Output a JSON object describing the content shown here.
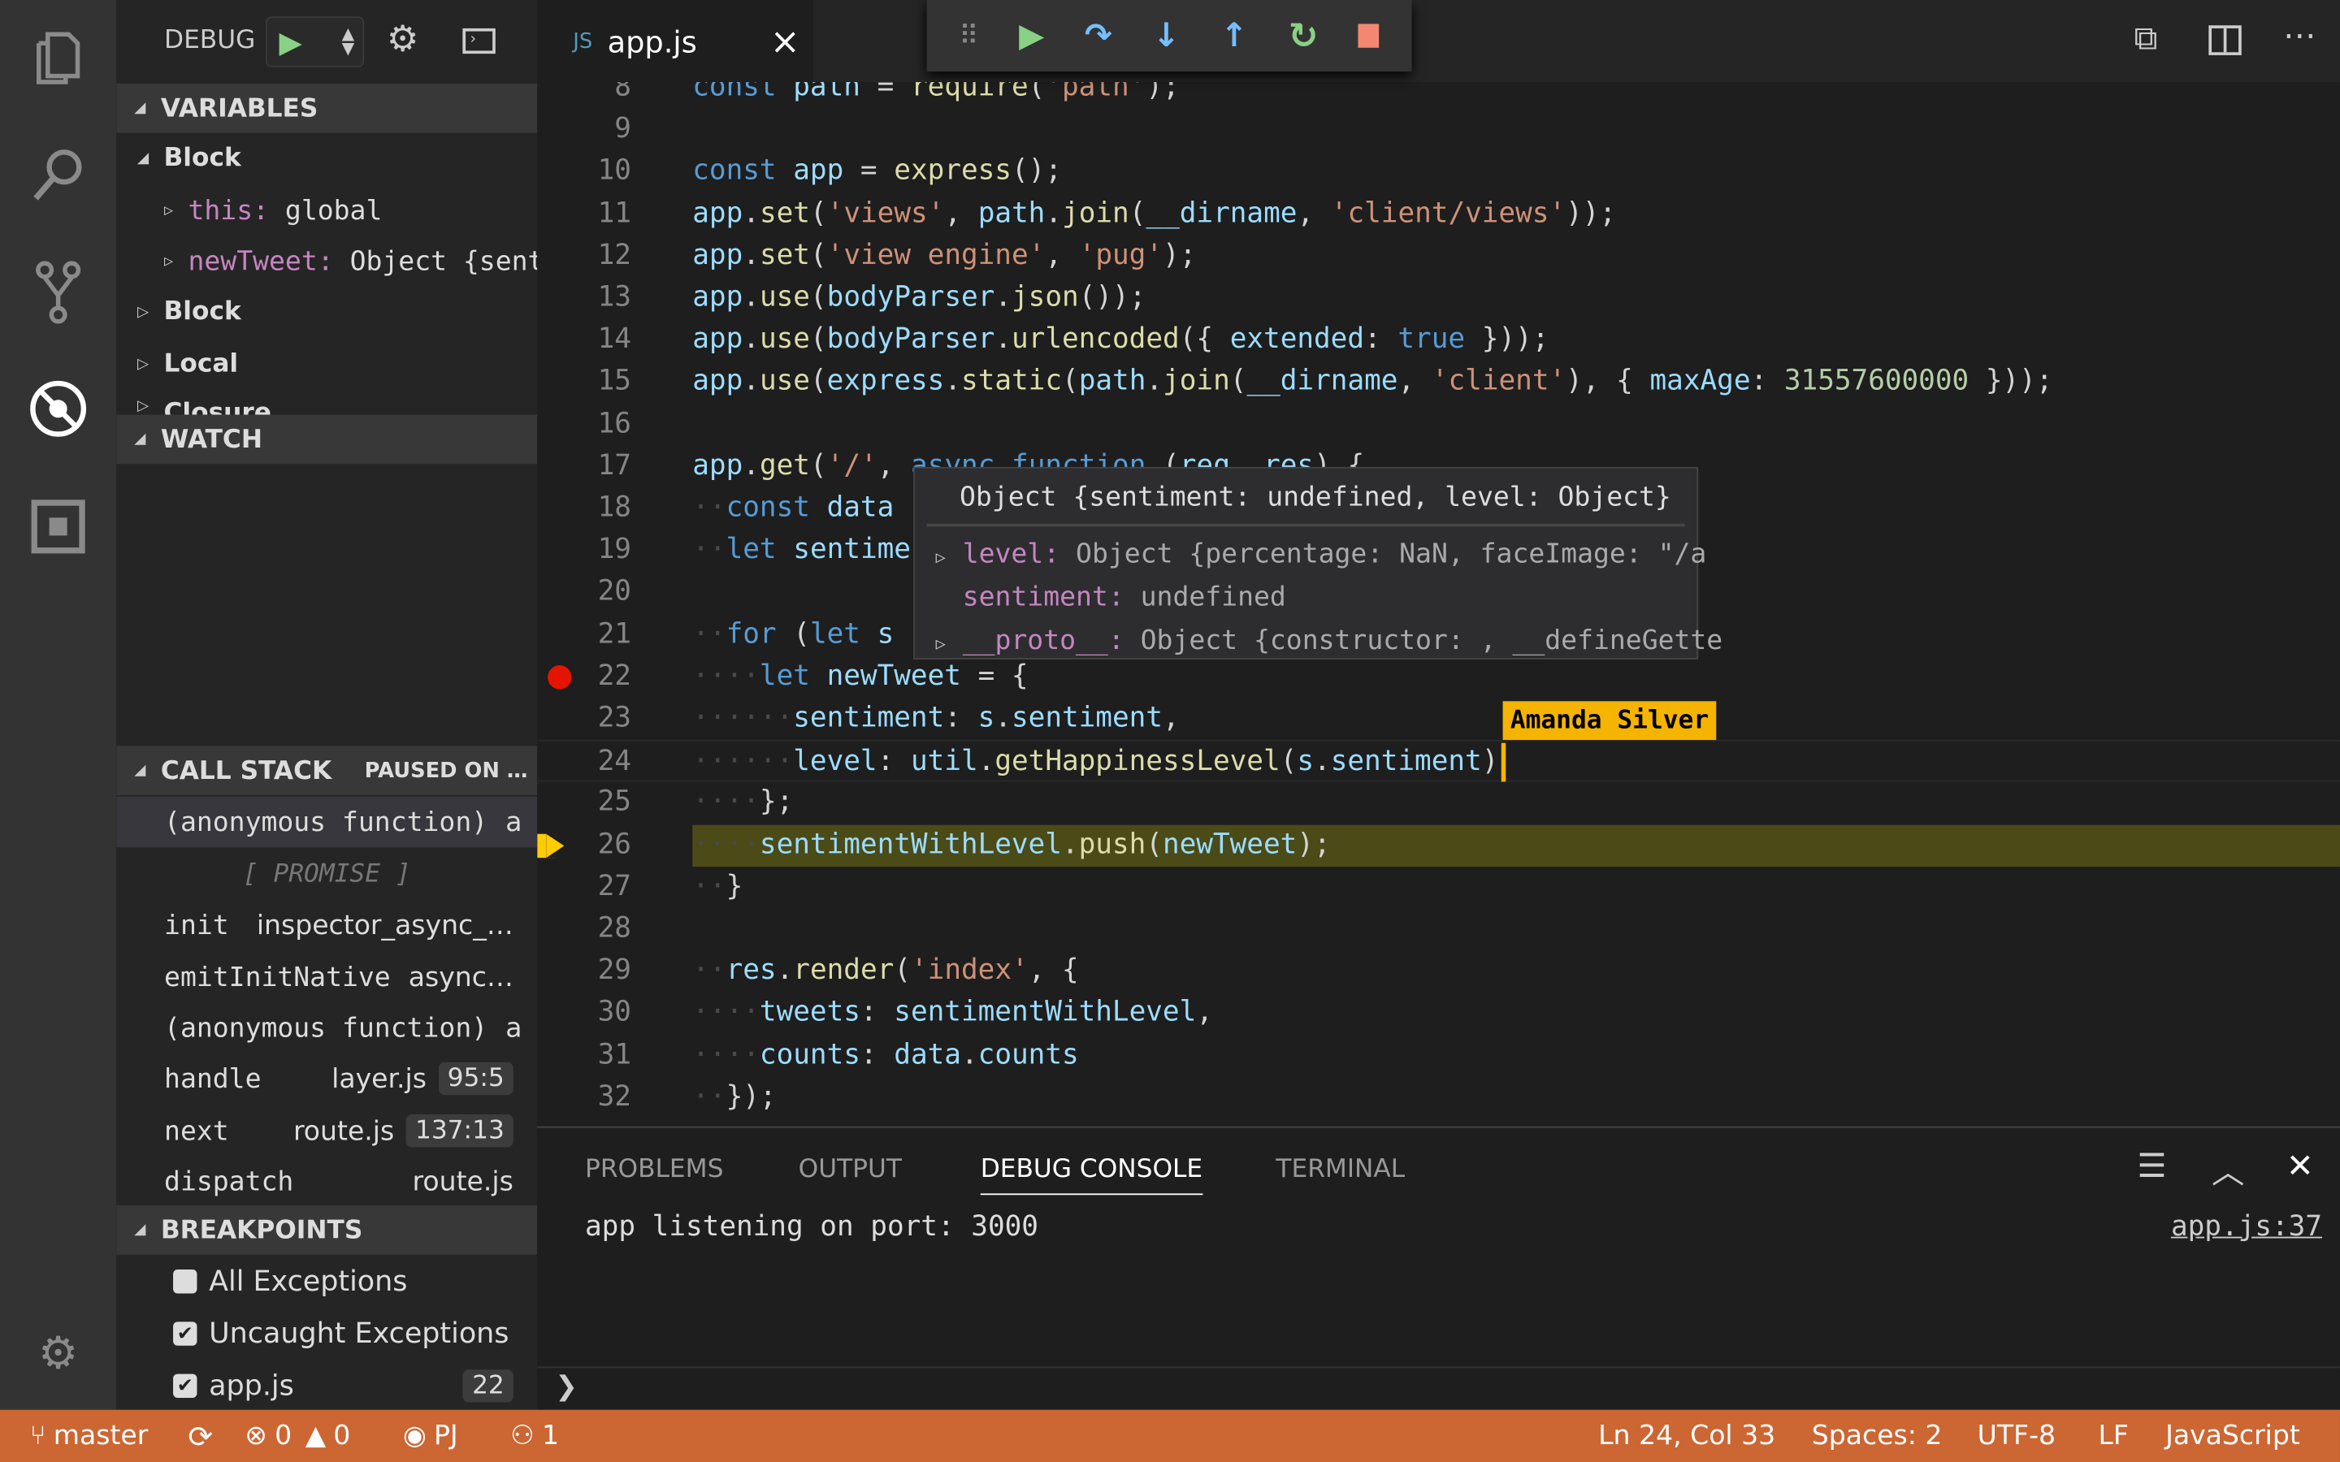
{
  "activity_bar": {
    "items": [
      "explorer-icon",
      "search-icon",
      "source-control-icon",
      "debug-icon",
      "extensions-icon"
    ],
    "settings": "gear-icon"
  },
  "debug_header": {
    "label": "DEBUG",
    "start": "play-icon",
    "config": "gear-icon",
    "console": "terminal-icon"
  },
  "variables": {
    "title": "VARIABLES",
    "items": [
      {
        "label": "Block",
        "expanded": true
      },
      {
        "name": "this:",
        "value": "global"
      },
      {
        "name": "newTweet:",
        "value": "Object {sent…"
      },
      {
        "label": "Block"
      },
      {
        "label": "Local"
      },
      {
        "label": "Closure"
      }
    ]
  },
  "watch": {
    "title": "WATCH"
  },
  "call_stack": {
    "title": "CALL STACK",
    "status": "PAUSED ON …",
    "promise": "[ PROMISE ]",
    "frames": [
      {
        "name": "(anonymous function)",
        "file": "a"
      },
      {
        "name": "init",
        "file": "inspector_async_…"
      },
      {
        "name": "emitInitNative",
        "file": "async…"
      },
      {
        "name": "(anonymous function)",
        "file": "a"
      },
      {
        "name": "handle",
        "file": "layer.js",
        "pos": "95:5"
      },
      {
        "name": "next",
        "file": "route.js",
        "pos": "137:13"
      },
      {
        "name": "dispatch",
        "file": "route.js"
      }
    ]
  },
  "breakpoints": {
    "title": "BREAKPOINTS",
    "items": [
      {
        "label": "All Exceptions",
        "checked": false
      },
      {
        "label": "Uncaught Exceptions",
        "checked": true
      },
      {
        "label": "app.js",
        "checked": true,
        "line": "22"
      }
    ]
  },
  "tab": {
    "icon": "JS",
    "name": "app.js",
    "close": "×"
  },
  "debug_toolbar": [
    "drag-handle-icon",
    "continue-icon",
    "step-over-icon",
    "step-into-icon",
    "step-out-icon",
    "restart-icon",
    "stop-icon"
  ],
  "editor": {
    "lines": [
      {
        "n": "8",
        "t": [
          [
            "const ",
            "kw"
          ],
          [
            "path",
            "var"
          ],
          [
            " = ",
            "pl"
          ],
          [
            "require",
            "fn"
          ],
          [
            "(",
            "pl"
          ],
          [
            "'path'",
            "str"
          ],
          [
            ");",
            "pl"
          ]
        ]
      },
      {
        "n": "9",
        "t": []
      },
      {
        "n": "10",
        "t": [
          [
            "const ",
            "kw"
          ],
          [
            "app",
            "var"
          ],
          [
            " = ",
            "pl"
          ],
          [
            "express",
            "fn"
          ],
          [
            "();",
            "pl"
          ]
        ]
      },
      {
        "n": "11",
        "t": [
          [
            "app",
            "var"
          ],
          [
            ".",
            "pl"
          ],
          [
            "set",
            "fn"
          ],
          [
            "(",
            "pl"
          ],
          [
            "'views'",
            "str"
          ],
          [
            ", ",
            "pl"
          ],
          [
            "path",
            "var"
          ],
          [
            ".",
            "pl"
          ],
          [
            "join",
            "fn"
          ],
          [
            "(",
            "pl"
          ],
          [
            "__dirname",
            "var"
          ],
          [
            ", ",
            "pl"
          ],
          [
            "'client/views'",
            "str"
          ],
          [
            "));",
            "pl"
          ]
        ]
      },
      {
        "n": "12",
        "t": [
          [
            "app",
            "var"
          ],
          [
            ".",
            "pl"
          ],
          [
            "set",
            "fn"
          ],
          [
            "(",
            "pl"
          ],
          [
            "'view engine'",
            "str"
          ],
          [
            ", ",
            "pl"
          ],
          [
            "'pug'",
            "str"
          ],
          [
            ");",
            "pl"
          ]
        ]
      },
      {
        "n": "13",
        "t": [
          [
            "app",
            "var"
          ],
          [
            ".",
            "pl"
          ],
          [
            "use",
            "fn"
          ],
          [
            "(",
            "pl"
          ],
          [
            "bodyParser",
            "var"
          ],
          [
            ".",
            "pl"
          ],
          [
            "json",
            "fn"
          ],
          [
            "());",
            "pl"
          ]
        ]
      },
      {
        "n": "14",
        "t": [
          [
            "app",
            "var"
          ],
          [
            ".",
            "pl"
          ],
          [
            "use",
            "fn"
          ],
          [
            "(",
            "pl"
          ],
          [
            "bodyParser",
            "var"
          ],
          [
            ".",
            "pl"
          ],
          [
            "urlencoded",
            "fn"
          ],
          [
            "({ ",
            "pl"
          ],
          [
            "extended",
            "var"
          ],
          [
            ": ",
            "pl"
          ],
          [
            "true",
            "kw"
          ],
          [
            " }));",
            "pl"
          ]
        ]
      },
      {
        "n": "15",
        "t": [
          [
            "app",
            "var"
          ],
          [
            ".",
            "pl"
          ],
          [
            "use",
            "fn"
          ],
          [
            "(",
            "pl"
          ],
          [
            "express",
            "var"
          ],
          [
            ".",
            "pl"
          ],
          [
            "static",
            "fn"
          ],
          [
            "(",
            "pl"
          ],
          [
            "path",
            "var"
          ],
          [
            ".",
            "pl"
          ],
          [
            "join",
            "fn"
          ],
          [
            "(",
            "pl"
          ],
          [
            "__dirname",
            "var"
          ],
          [
            ", ",
            "pl"
          ],
          [
            "'client'",
            "str"
          ],
          [
            "), { ",
            "pl"
          ],
          [
            "maxAge",
            "var"
          ],
          [
            ": ",
            "pl"
          ],
          [
            "31557600000",
            "nm"
          ],
          [
            " }));",
            "pl"
          ]
        ]
      },
      {
        "n": "16",
        "t": []
      },
      {
        "n": "17",
        "t": [
          [
            "app",
            "var"
          ],
          [
            ".",
            "pl"
          ],
          [
            "get",
            "fn"
          ],
          [
            "(",
            "pl"
          ],
          [
            "'/'",
            "str"
          ],
          [
            ", ",
            "pl"
          ],
          [
            "async ",
            "kw"
          ],
          [
            "function ",
            "kw"
          ],
          [
            "(",
            "pl"
          ],
          [
            "req",
            "var"
          ],
          [
            ", ",
            "pl"
          ],
          [
            "res",
            "var"
          ],
          [
            ") {",
            "pl"
          ]
        ]
      },
      {
        "n": "18",
        "t": [
          [
            "··",
            "ws"
          ],
          [
            "const ",
            "kw"
          ],
          [
            "data",
            "var"
          ]
        ]
      },
      {
        "n": "19",
        "t": [
          [
            "··",
            "ws"
          ],
          [
            "let ",
            "kw"
          ],
          [
            "sentime",
            "var"
          ]
        ]
      },
      {
        "n": "20",
        "t": []
      },
      {
        "n": "21",
        "t": [
          [
            "··",
            "ws"
          ],
          [
            "for ",
            "kw"
          ],
          [
            "(",
            "pl"
          ],
          [
            "let ",
            "kw"
          ],
          [
            "s",
            "var"
          ]
        ]
      },
      {
        "n": "22",
        "t": [
          [
            "····",
            "ws"
          ],
          [
            "let ",
            "kw"
          ],
          [
            "newTweet",
            "var"
          ],
          [
            " = {",
            "pl"
          ]
        ],
        "breakpoint": true
      },
      {
        "n": "23",
        "t": [
          [
            "······",
            "ws"
          ],
          [
            "sentiment",
            "var"
          ],
          [
            ": ",
            "pl"
          ],
          [
            "s",
            "var"
          ],
          [
            ".",
            "pl"
          ],
          [
            "sentiment",
            "var"
          ],
          [
            ",",
            "pl"
          ]
        ]
      },
      {
        "n": "24",
        "t": [
          [
            "······",
            "ws"
          ],
          [
            "level",
            "var"
          ],
          [
            ": ",
            "pl"
          ],
          [
            "util",
            "var"
          ],
          [
            ".",
            "pl"
          ],
          [
            "getHappinessLevel",
            "fn"
          ],
          [
            "(",
            "pl"
          ],
          [
            "s",
            "var"
          ],
          [
            ".",
            "pl"
          ],
          [
            "sentiment",
            "var"
          ],
          [
            ")",
            "pl"
          ]
        ],
        "current": true
      },
      {
        "n": "25",
        "t": [
          [
            "····",
            "ws"
          ],
          [
            "};",
            "pl"
          ]
        ]
      },
      {
        "n": "26",
        "t": [
          [
            "····",
            "ws"
          ],
          [
            "sentimentWithLevel",
            "var"
          ],
          [
            ".",
            "pl"
          ],
          [
            "push",
            "fn"
          ],
          [
            "(",
            "pl"
          ],
          [
            "newTweet",
            "var"
          ],
          [
            ");",
            "pl"
          ]
        ],
        "paused": true
      },
      {
        "n": "27",
        "t": [
          [
            "··",
            "ws"
          ],
          [
            "}",
            "pl"
          ]
        ]
      },
      {
        "n": "28",
        "t": []
      },
      {
        "n": "29",
        "t": [
          [
            "··",
            "ws"
          ],
          [
            "res",
            "var"
          ],
          [
            ".",
            "pl"
          ],
          [
            "render",
            "fn"
          ],
          [
            "(",
            "pl"
          ],
          [
            "'index'",
            "str"
          ],
          [
            ", {",
            "pl"
          ]
        ]
      },
      {
        "n": "30",
        "t": [
          [
            "····",
            "ws"
          ],
          [
            "tweets",
            "var"
          ],
          [
            ": ",
            "pl"
          ],
          [
            "sentimentWithLevel",
            "var"
          ],
          [
            ",",
            "pl"
          ]
        ]
      },
      {
        "n": "31",
        "t": [
          [
            "····",
            "ws"
          ],
          [
            "counts",
            "var"
          ],
          [
            ": ",
            "pl"
          ],
          [
            "data",
            "var"
          ],
          [
            ".",
            "pl"
          ],
          [
            "counts",
            "var"
          ]
        ]
      },
      {
        "n": "32",
        "t": [
          [
            "··",
            "ws"
          ],
          [
            "});",
            "pl"
          ]
        ]
      }
    ],
    "collaborator": "Amanda Silver",
    "colors": {
      "breakpoint": "#e51400",
      "paused_line": "#4b4b18",
      "collaborator": "#f5b400"
    }
  },
  "hover": {
    "title": "Object {sentiment: undefined, level: Object}",
    "rows": [
      {
        "expand": true,
        "key": "level:",
        "value": " Object {percentage: NaN, faceImage: \"/a"
      },
      {
        "expand": false,
        "key": "sentiment:",
        "value": " undefined"
      },
      {
        "expand": true,
        "key": "__proto__:",
        "value": " Object {constructor: , __defineGette"
      }
    ]
  },
  "panel": {
    "tabs": [
      "PROBLEMS",
      "OUTPUT",
      "DEBUG CONSOLE",
      "TERMINAL"
    ],
    "active": "DEBUG CONSOLE",
    "output": "app listening on port: 3000",
    "source": "app.js:37",
    "prompt": "❯"
  },
  "status_bar": {
    "branch": "master",
    "errors": "0",
    "warnings": "0",
    "live_share": "PJ",
    "participants": "1",
    "position": "Ln 24, Col 33",
    "spaces": "Spaces: 2",
    "encoding": "UTF-8",
    "eol": "LF",
    "language": "JavaScript",
    "color": "#cc6633"
  }
}
